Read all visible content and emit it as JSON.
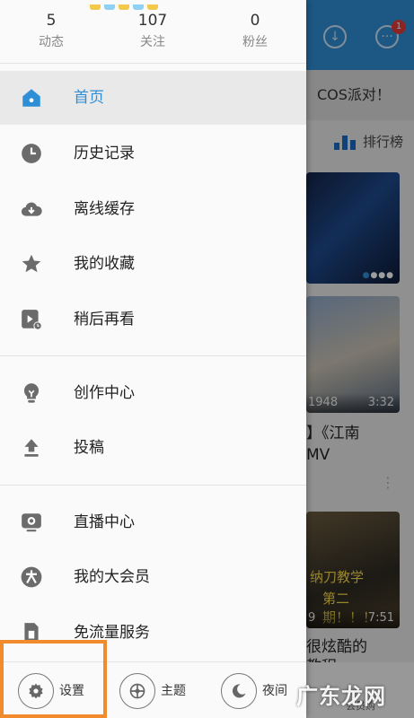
{
  "drawer": {
    "stats": [
      {
        "value": "5",
        "label": "动态"
      },
      {
        "value": "107",
        "label": "关注"
      },
      {
        "value": "0",
        "label": "粉丝"
      }
    ],
    "menu_group1": [
      {
        "label": "首页",
        "icon": "home-icon",
        "active": true
      },
      {
        "label": "历史记录",
        "icon": "clock-icon"
      },
      {
        "label": "离线缓存",
        "icon": "cloud-download-icon"
      },
      {
        "label": "我的收藏",
        "icon": "star-icon"
      },
      {
        "label": "稍后再看",
        "icon": "watch-later-icon"
      }
    ],
    "menu_group2": [
      {
        "label": "创作中心",
        "icon": "lightbulb-icon"
      },
      {
        "label": "投稿",
        "icon": "upload-icon"
      }
    ],
    "menu_group3": [
      {
        "label": "直播中心",
        "icon": "live-tv-icon"
      },
      {
        "label": "我的大会员",
        "icon": "vip-icon"
      },
      {
        "label": "免流量服务",
        "icon": "sim-card-icon"
      }
    ],
    "bottom": {
      "settings_label": "设置",
      "theme_label": "主题",
      "night_label": "夜间"
    }
  },
  "background": {
    "notification_count": "1",
    "banner_text": "COS派对！",
    "ranking_label": "排行榜",
    "card2_views": "1948",
    "card2_duration": "3:32",
    "card2_title_line1": "】《江南",
    "card2_title_line2": "MV",
    "card3_text1": "纳刀教学",
    "card3_text2": "第二期！！！",
    "card3_views": "9",
    "card3_duration": "7:51",
    "card3_title_line1": "很炫酷的",
    "card3_title_line2": "教程",
    "vip_shop_label": "会员购"
  },
  "watermark": "广东龙网",
  "colors": {
    "accent": "#2f8fd6",
    "highlight_box": "#f28a2e",
    "badge": "#e23b3b"
  }
}
